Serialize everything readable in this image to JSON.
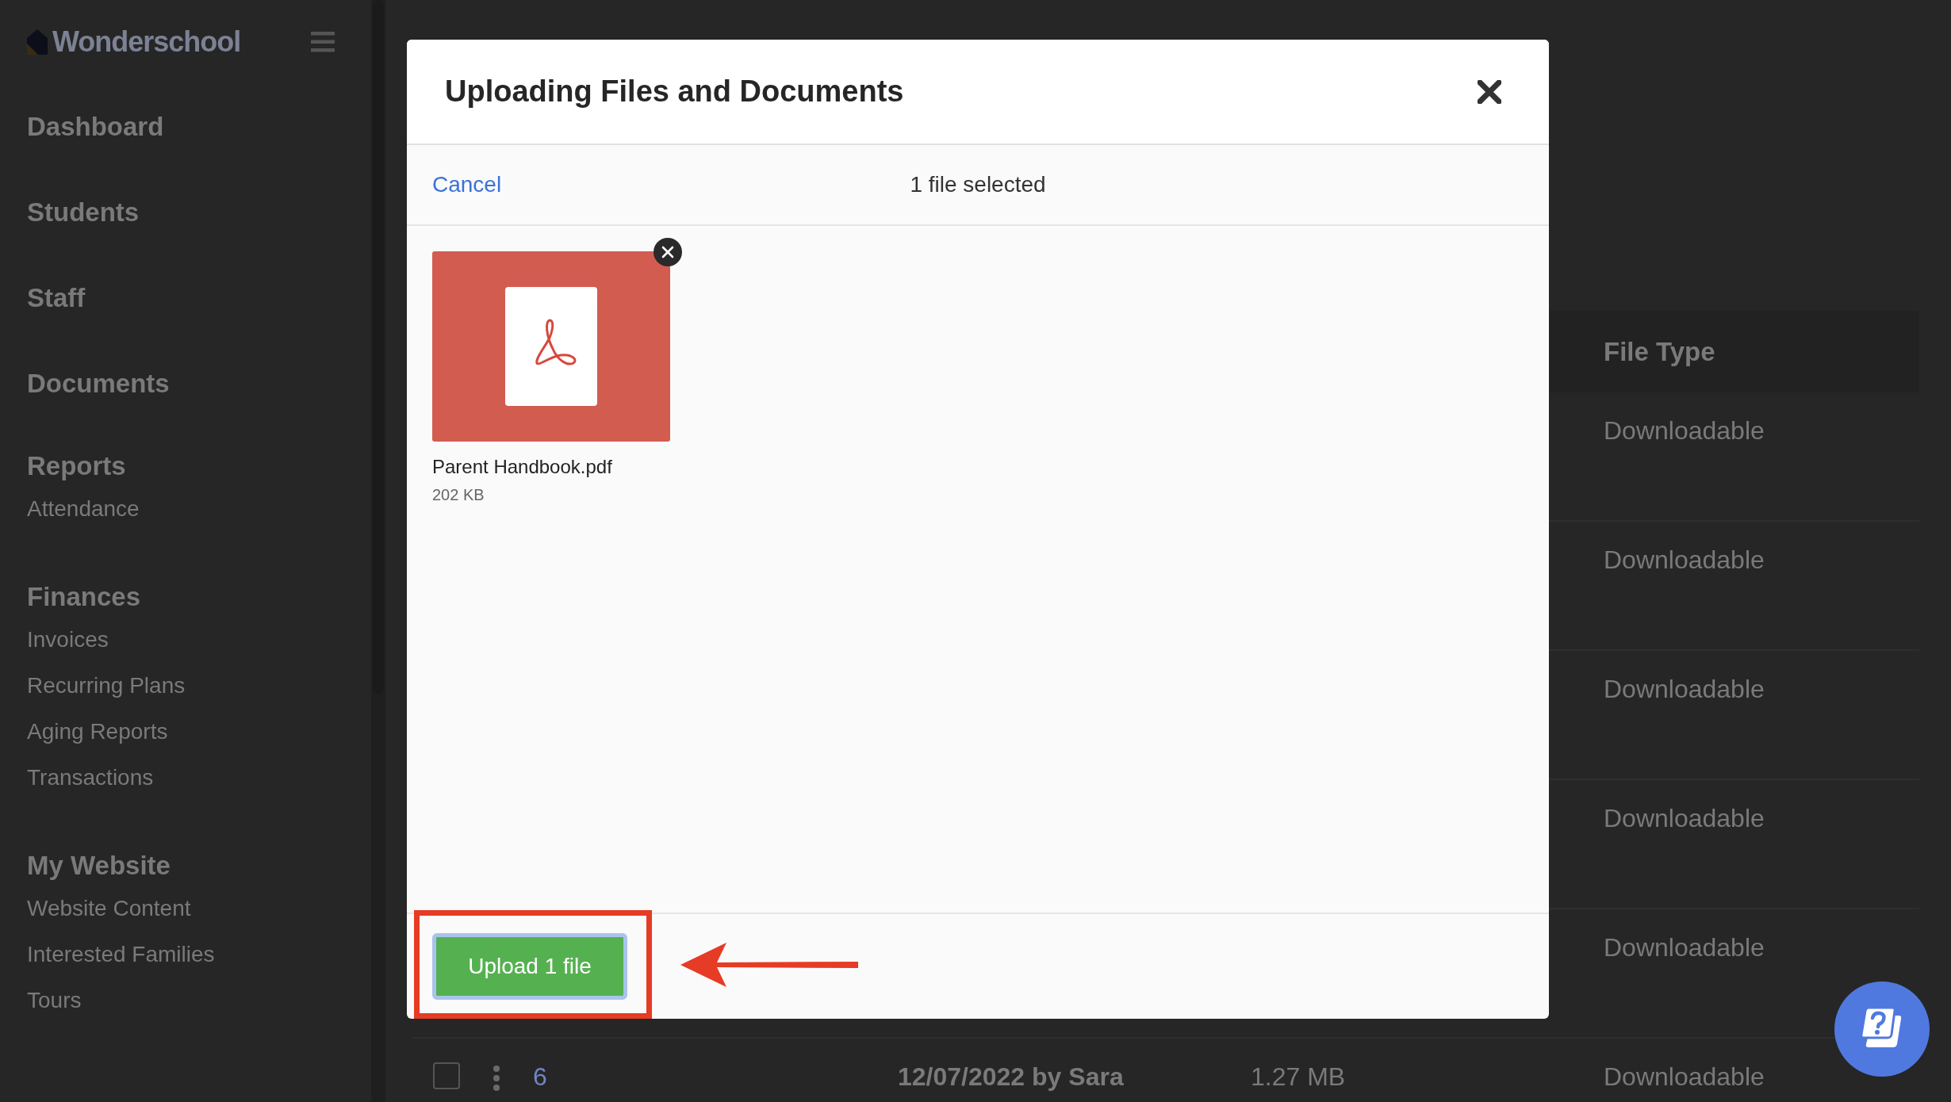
{
  "sidebar": {
    "brand": "Wonderschool",
    "links": [
      {
        "label": "Dashboard"
      },
      {
        "label": "Students"
      },
      {
        "label": "Staff"
      },
      {
        "label": "Documents"
      }
    ],
    "sections": [
      {
        "title": "Reports",
        "items": [
          "Attendance"
        ]
      },
      {
        "title": "Finances",
        "items": [
          "Invoices",
          "Recurring Plans",
          "Aging Reports",
          "Transactions"
        ]
      },
      {
        "title": "My Website",
        "items": [
          "Website Content",
          "Interested Families",
          "Tours"
        ]
      }
    ]
  },
  "table": {
    "columns": [
      {
        "kind": "file_type",
        "label": "File Type"
      }
    ],
    "rows": [
      {
        "file_type": "Downloadable"
      },
      {
        "file_type": "Downloadable"
      },
      {
        "file_type": "Downloadable"
      },
      {
        "file_type": "Downloadable"
      },
      {
        "file_type": "Downloadable"
      },
      {
        "checked": false,
        "number": "6",
        "date": "12/07/2022 by Sara",
        "size": "1.27 MB",
        "file_type": "Downloadable"
      }
    ]
  },
  "modal": {
    "title": "Uploading Files and Documents",
    "cancel": "Cancel",
    "status": "1 file selected",
    "files": [
      {
        "kind": "pdf",
        "name": "Parent Handbook.pdf",
        "size": "202 KB"
      }
    ],
    "upload_button": "Upload 1 file"
  },
  "callouts": {
    "highlight_frame": true,
    "arrow": true
  }
}
